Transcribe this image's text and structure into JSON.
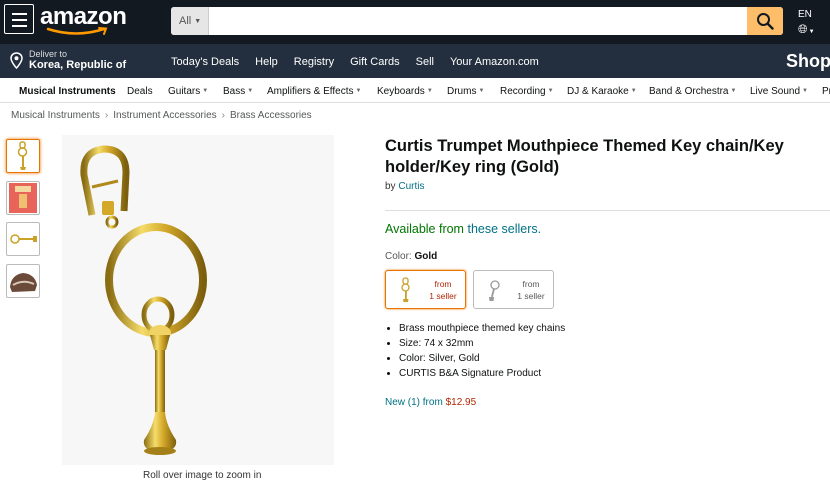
{
  "header": {
    "logo": "amazon",
    "search_category": "All",
    "search_value": "",
    "language": "EN"
  },
  "nav": {
    "deliver_to_label": "Deliver to",
    "deliver_to_location": "Korea, Republic of",
    "links": [
      "Today's Deals",
      "Help",
      "Registry",
      "Gift Cards",
      "Sell",
      "Your Amazon.com"
    ],
    "shop_text": "Shop"
  },
  "subnav": {
    "items": [
      "Musical Instruments",
      "Deals",
      "Guitars",
      "Bass",
      "Amplifiers & Effects",
      "Keyboards",
      "Drums",
      "Recording",
      "DJ & Karaoke",
      "Band & Orchestra",
      "Live Sound",
      "Pr"
    ]
  },
  "breadcrumb": [
    "Musical Instruments",
    "Instrument Accessories",
    "Brass Accessories"
  ],
  "product": {
    "title": "Curtis Trumpet Mouthpiece Themed Key chain/Key holder/Key ring (Gold)",
    "by_label": "by",
    "brand": "Curtis",
    "availability_prefix": "Available from",
    "availability_link": "these sellers.",
    "color_label": "Color:",
    "color_value": "Gold",
    "swatches": [
      {
        "line1": "from",
        "line2": "1 seller",
        "selected": true
      },
      {
        "line1": "from",
        "line2": "1 seller",
        "selected": false
      }
    ],
    "bullets": [
      "Brass mouthpiece themed key chains",
      "Size: 74 x 32mm",
      "Color: Silver, Gold",
      "CURTIS B&A Signature Product"
    ],
    "offer_prefix": "New (1) from",
    "offer_price": "$12.95",
    "zoom_hint": "Roll over image to zoom in"
  },
  "colors": {
    "nav_dark": "#131921",
    "nav_secondary": "#232f3e",
    "search_button": "#febd69",
    "link": "#007185",
    "available_green": "#007600",
    "price_red": "#b12704",
    "selected_orange": "#e77600",
    "gold": "#d4a829"
  }
}
